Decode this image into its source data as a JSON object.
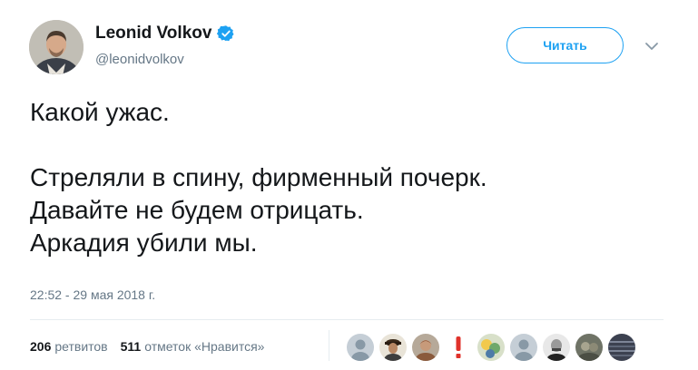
{
  "author": {
    "display_name": "Leonid Volkov",
    "handle": "@leonidvolkov",
    "verified_icon": "verified-badge-icon"
  },
  "follow_button": {
    "label": "Читать"
  },
  "menu_caret": {
    "icon": "chevron-down-icon"
  },
  "tweet": {
    "lines": [
      "Какой ужас.",
      "Стреляли в спину, фирменный почерк.",
      "Давайте не будем отрицать.",
      "Аркадия убили мы."
    ],
    "timestamp": "22:52 - 29 мая 2018 г."
  },
  "stats": {
    "retweets_count": "206",
    "retweets_label": "ретвитов",
    "likes_count": "511",
    "likes_label": "отметок «Нравится»"
  },
  "likers": [
    {
      "icon": "default-avatar-icon"
    },
    {
      "icon": "user-avatar-icon"
    },
    {
      "icon": "user-avatar-icon"
    },
    {
      "icon": "exclamation-avatar-icon"
    },
    {
      "icon": "user-avatar-icon"
    },
    {
      "icon": "default-avatar-icon"
    },
    {
      "icon": "user-avatar-icon"
    },
    {
      "icon": "user-avatar-icon"
    },
    {
      "icon": "user-avatar-icon"
    }
  ],
  "colors": {
    "accent": "#1da1f2",
    "text": "#14171a",
    "secondary": "#657786",
    "divider": "#e6ecf0"
  }
}
